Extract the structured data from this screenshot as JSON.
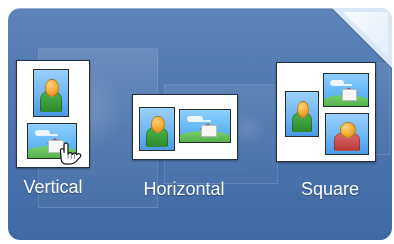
{
  "options": [
    {
      "key": "vertical",
      "label": "Vertical",
      "icons": [
        "person-icon",
        "landscape-icon"
      ]
    },
    {
      "key": "horizontal",
      "label": "Horizontal",
      "icons": [
        "person-icon",
        "landscape-icon"
      ]
    },
    {
      "key": "square",
      "label": "Square",
      "icons": [
        "person-icon",
        "landscape-icon",
        "person-icon-red"
      ]
    }
  ],
  "pointer": {
    "icon": "hand-cursor-icon"
  },
  "colors": {
    "panel": "#4a74ad",
    "card": "#ffffff",
    "label": "#ffffff"
  }
}
